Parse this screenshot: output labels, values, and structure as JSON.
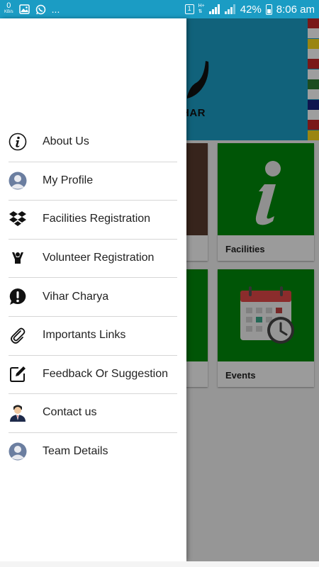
{
  "status_bar": {
    "speed_value": "0",
    "speed_unit": "KB/s",
    "overflow": "...",
    "sim_label": "1",
    "network_label": "H+",
    "battery": "42%",
    "time": "8:06 am"
  },
  "background": {
    "banner_text": "HAR",
    "tiles": [
      {
        "caption": "Facilities",
        "icon": "info-icon"
      },
      {
        "caption": "Events",
        "icon": "calendar-clock-icon"
      }
    ]
  },
  "drawer": {
    "items": [
      {
        "label": "About Us",
        "icon": "info-circle-icon"
      },
      {
        "label": "My Profile",
        "icon": "user-avatar-icon"
      },
      {
        "label": "Facilities Registration",
        "icon": "dropbox-icon"
      },
      {
        "label": "Volunteer Registration",
        "icon": "volunteer-icon"
      },
      {
        "label": "Vihar Charya",
        "icon": "speech-bubble-exclamation-icon"
      },
      {
        "label": "Importants Links",
        "icon": "paperclip-icon"
      },
      {
        "label": "Feedback Or Suggestion",
        "icon": "edit-icon"
      },
      {
        "label": "Contact us",
        "icon": "contact-person-icon"
      },
      {
        "label": "Team Details",
        "icon": "user-avatar-icon"
      }
    ]
  },
  "colors": {
    "status_bar": "#1b9cc4",
    "banner": "#1c9ec7",
    "tile": "#008a0b"
  }
}
